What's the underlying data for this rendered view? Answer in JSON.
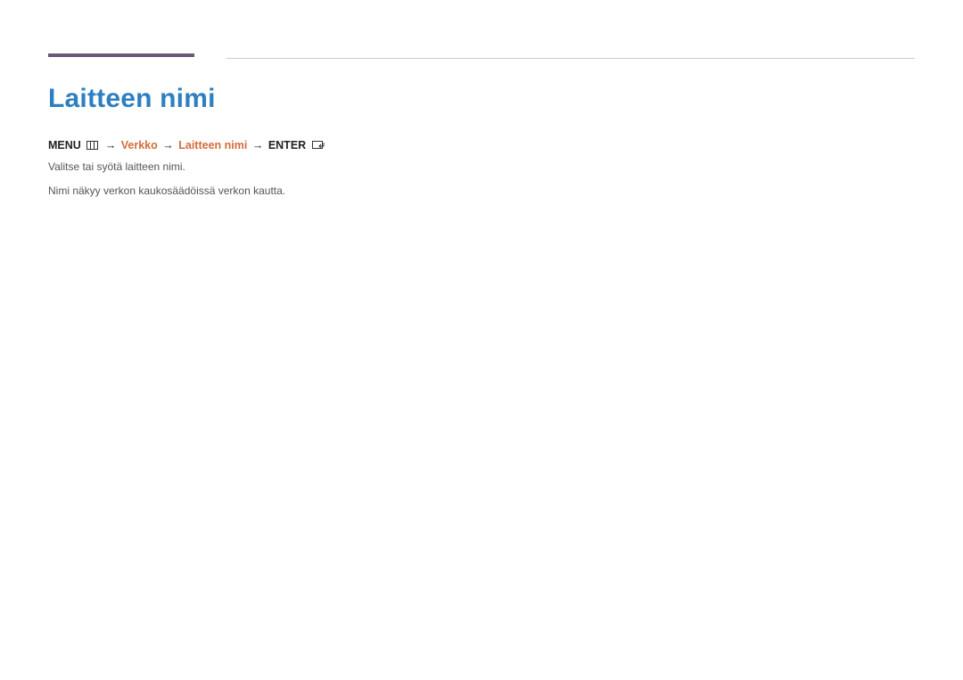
{
  "heading": "Laitteen nimi",
  "path": {
    "menu_label": "MENU",
    "segment1": "Verkko",
    "segment2": "Laitteen nimi",
    "enter_label": "ENTER"
  },
  "body": {
    "line1": "Valitse tai syötä laitteen nimi.",
    "line2": "Nimi näkyy verkon kaukosäädöissä verkon kautta."
  }
}
